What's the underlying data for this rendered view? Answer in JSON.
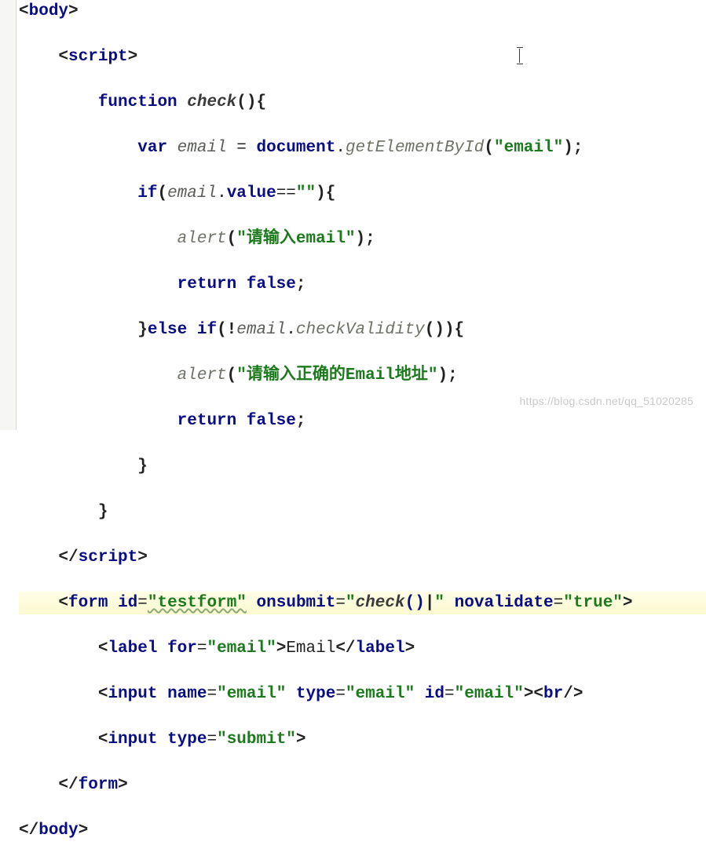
{
  "t": {
    "body_open": "body",
    "script_open": "script",
    "script_close": "script",
    "form": "form",
    "label": "label",
    "input": "input",
    "br": "br",
    "body_close": "body"
  },
  "kw": {
    "function": "function",
    "var": "var",
    "if": "if",
    "else_if": "else if",
    "return": "return",
    "false": "false"
  },
  "fn": {
    "check": "check",
    "alert1": "alert",
    "alert2": "alert",
    "getElementById": "getElementById",
    "checkValidity": "checkValidity"
  },
  "id": {
    "email_decl": "email",
    "document": "document",
    "email_ref1": "email",
    "value": "value",
    "email_ref2": "email"
  },
  "str": {
    "email_id": "\"email\"",
    "empty": "\"\"",
    "alert1": "\"请输入email\"",
    "alert2": "\"请输入正确的Email地址\"",
    "form_id": "\"testform\"",
    "onsubmit": "\"check()|\"",
    "novalidate": "\"true\"",
    "for_email": "\"email\"",
    "name_email": "\"email\"",
    "type_email": "\"email\"",
    "id_email": "\"email\"",
    "type_submit": "\"submit\""
  },
  "attr": {
    "id": "id",
    "onsubmit": "onsubmit",
    "novalidate": "novalidate",
    "for": "for",
    "name": "name",
    "type": "type",
    "id2": "id",
    "type2": "type"
  },
  "text": {
    "email_label": "Email"
  },
  "watermark": "https://blog.csdn.net/qq_51020285"
}
